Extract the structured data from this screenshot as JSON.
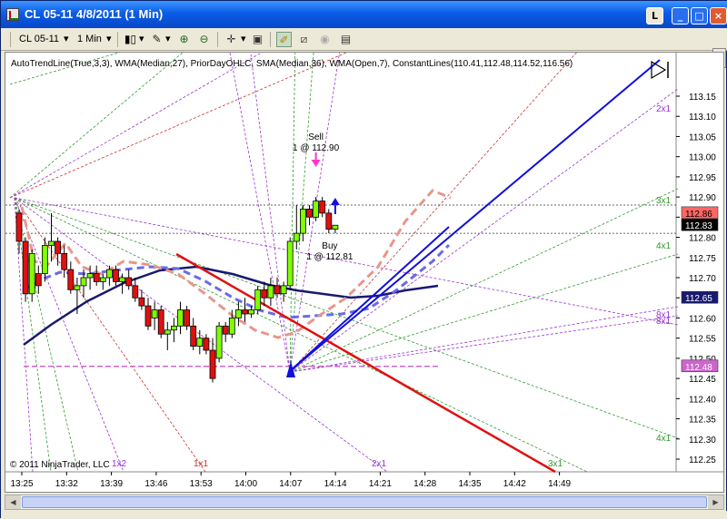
{
  "window": {
    "title": "CL 05-11  4/8/2011 (1 Min)",
    "restore_left": "L",
    "minimize": "_",
    "maximize": "□",
    "close": "×"
  },
  "toolbar": {
    "instrument": "CL 05-11",
    "interval": "1 Min"
  },
  "chart_data": {
    "type": "candlestick",
    "indicators_label": "AutoTrendLine(True,3,3), WMA(Median,27), PriorDayOHLC, SMA(Median,36), WMA(Open,7), ConstantLines(110.41,112.48,114.52,116.56)",
    "copyright": "© 2011 NinjaTrader, LLC",
    "ylim": [
      112.21,
      113.18
    ],
    "y_ticks": [
      113.15,
      113.1,
      113.05,
      113.0,
      112.95,
      112.9,
      112.85,
      112.8,
      112.75,
      112.7,
      112.65,
      112.6,
      112.55,
      112.5,
      112.45,
      112.4,
      112.35,
      112.3,
      112.25
    ],
    "y_tick_labels": [
      "113.15",
      "113.10",
      "113.05",
      "113.00",
      "112.95",
      "112.90",
      "112.85",
      "112.80",
      "112.75",
      "112.70",
      "112.65",
      "112.60",
      "112.55",
      "112.50",
      "112.45",
      "112.40",
      "112.35",
      "112.30",
      "112.25"
    ],
    "x_tick_labels": [
      "13:25",
      "13:32",
      "13:39",
      "13:46",
      "13:53",
      "14:00",
      "14:07",
      "14:14",
      "14:21",
      "14:28",
      "14:35",
      "14:42",
      "14:49"
    ],
    "price_markers": [
      {
        "value": 112.86,
        "label": "112.86",
        "color": "#ff6666"
      },
      {
        "value": 112.83,
        "label": "112.83",
        "color": "#000000"
      },
      {
        "value": 112.65,
        "label": "112.65",
        "color": "#191970"
      },
      {
        "value": 112.48,
        "label": "112.48",
        "color": "#cc66cc"
      }
    ],
    "gann_labels": [
      {
        "text": "2x1",
        "color": "#9933cc"
      },
      {
        "text": "3x1",
        "color": "#339933"
      },
      {
        "text": "4x1",
        "color": "#339933"
      },
      {
        "text": "8x1",
        "color": "#9933cc"
      },
      {
        "text": "8x1",
        "color": "#9933cc"
      },
      {
        "text": "4x1",
        "color": "#339933"
      },
      {
        "text": "1x1",
        "color": "#cc3333"
      },
      {
        "text": "2x1",
        "color": "#9933cc"
      },
      {
        "text": "3x1",
        "color": "#339933"
      },
      {
        "text": "1x2",
        "color": "#9933cc"
      }
    ],
    "trade_sell": {
      "action": "Sell",
      "detail": "1 @ 112.90"
    },
    "trade_buy": {
      "action": "Buy",
      "detail": "1 @ 112.81"
    },
    "candles": [
      {
        "t": 0,
        "o": 112.86,
        "h": 112.87,
        "l": 112.76,
        "c": 112.79
      },
      {
        "t": 1,
        "o": 112.79,
        "h": 112.8,
        "l": 112.64,
        "c": 112.66
      },
      {
        "t": 2,
        "o": 112.66,
        "h": 112.77,
        "l": 112.64,
        "c": 112.76
      },
      {
        "t": 3,
        "o": 112.71,
        "h": 112.73,
        "l": 112.66,
        "c": 112.68
      },
      {
        "t": 4,
        "o": 112.71,
        "h": 112.8,
        "l": 112.69,
        "c": 112.78
      },
      {
        "t": 5,
        "o": 112.78,
        "h": 112.86,
        "l": 112.74,
        "c": 112.79
      },
      {
        "t": 6,
        "o": 112.79,
        "h": 112.8,
        "l": 112.73,
        "c": 112.76
      },
      {
        "t": 7,
        "o": 112.76,
        "h": 112.78,
        "l": 112.7,
        "c": 112.72
      },
      {
        "t": 8,
        "o": 112.72,
        "h": 112.74,
        "l": 112.66,
        "c": 112.67
      },
      {
        "t": 9,
        "o": 112.67,
        "h": 112.7,
        "l": 112.61,
        "c": 112.68
      },
      {
        "t": 10,
        "o": 112.68,
        "h": 112.72,
        "l": 112.65,
        "c": 112.7
      },
      {
        "t": 11,
        "o": 112.7,
        "h": 112.73,
        "l": 112.67,
        "c": 112.71
      },
      {
        "t": 12,
        "o": 112.71,
        "h": 112.73,
        "l": 112.68,
        "c": 112.69
      },
      {
        "t": 13,
        "o": 112.69,
        "h": 112.71,
        "l": 112.67,
        "c": 112.7
      },
      {
        "t": 14,
        "o": 112.7,
        "h": 112.73,
        "l": 112.68,
        "c": 112.72
      },
      {
        "t": 15,
        "o": 112.72,
        "h": 112.73,
        "l": 112.68,
        "c": 112.69
      },
      {
        "t": 16,
        "o": 112.69,
        "h": 112.71,
        "l": 112.66,
        "c": 112.7
      },
      {
        "t": 17,
        "o": 112.7,
        "h": 112.72,
        "l": 112.67,
        "c": 112.68
      },
      {
        "t": 18,
        "o": 112.68,
        "h": 112.7,
        "l": 112.64,
        "c": 112.65
      },
      {
        "t": 19,
        "o": 112.65,
        "h": 112.67,
        "l": 112.62,
        "c": 112.63
      },
      {
        "t": 20,
        "o": 112.63,
        "h": 112.65,
        "l": 112.57,
        "c": 112.58
      },
      {
        "t": 21,
        "o": 112.6,
        "h": 112.64,
        "l": 112.57,
        "c": 112.62
      },
      {
        "t": 22,
        "o": 112.62,
        "h": 112.63,
        "l": 112.55,
        "c": 112.56
      },
      {
        "t": 23,
        "o": 112.56,
        "h": 112.59,
        "l": 112.52,
        "c": 112.57
      },
      {
        "t": 24,
        "o": 112.57,
        "h": 112.6,
        "l": 112.54,
        "c": 112.58
      },
      {
        "t": 25,
        "o": 112.58,
        "h": 112.64,
        "l": 112.56,
        "c": 112.62
      },
      {
        "t": 26,
        "o": 112.62,
        "h": 112.63,
        "l": 112.57,
        "c": 112.58
      },
      {
        "t": 27,
        "o": 112.58,
        "h": 112.6,
        "l": 112.52,
        "c": 112.53
      },
      {
        "t": 28,
        "o": 112.53,
        "h": 112.57,
        "l": 112.51,
        "c": 112.55
      },
      {
        "t": 29,
        "o": 112.55,
        "h": 112.56,
        "l": 112.51,
        "c": 112.52
      },
      {
        "t": 30,
        "o": 112.52,
        "h": 112.55,
        "l": 112.44,
        "c": 112.45
      },
      {
        "t": 31,
        "o": 112.5,
        "h": 112.59,
        "l": 112.49,
        "c": 112.58
      },
      {
        "t": 32,
        "o": 112.58,
        "h": 112.59,
        "l": 112.54,
        "c": 112.56
      },
      {
        "t": 33,
        "o": 112.56,
        "h": 112.62,
        "l": 112.55,
        "c": 112.6
      },
      {
        "t": 34,
        "o": 112.6,
        "h": 112.64,
        "l": 112.58,
        "c": 112.62
      },
      {
        "t": 35,
        "o": 112.62,
        "h": 112.65,
        "l": 112.59,
        "c": 112.61
      },
      {
        "t": 36,
        "o": 112.61,
        "h": 112.63,
        "l": 112.6,
        "c": 112.62
      },
      {
        "t": 37,
        "o": 112.62,
        "h": 112.68,
        "l": 112.61,
        "c": 112.67
      },
      {
        "t": 38,
        "o": 112.67,
        "h": 112.69,
        "l": 112.63,
        "c": 112.65
      },
      {
        "t": 39,
        "o": 112.65,
        "h": 112.7,
        "l": 112.63,
        "c": 112.68
      },
      {
        "t": 40,
        "o": 112.68,
        "h": 112.7,
        "l": 112.65,
        "c": 112.66
      },
      {
        "t": 41,
        "o": 112.66,
        "h": 112.69,
        "l": 112.64,
        "c": 112.68
      },
      {
        "t": 42,
        "o": 112.68,
        "h": 112.8,
        "l": 112.67,
        "c": 112.79
      },
      {
        "t": 43,
        "o": 112.79,
        "h": 112.88,
        "l": 112.77,
        "c": 112.81
      },
      {
        "t": 44,
        "o": 112.81,
        "h": 112.88,
        "l": 112.79,
        "c": 112.87
      },
      {
        "t": 45,
        "o": 112.87,
        "h": 112.88,
        "l": 112.83,
        "c": 112.85
      },
      {
        "t": 46,
        "o": 112.85,
        "h": 112.9,
        "l": 112.84,
        "c": 112.89
      },
      {
        "t": 47,
        "o": 112.89,
        "h": 112.9,
        "l": 112.85,
        "c": 112.86
      },
      {
        "t": 48,
        "o": 112.86,
        "h": 112.87,
        "l": 112.81,
        "c": 112.82
      },
      {
        "t": 49,
        "o": 112.82,
        "h": 112.83,
        "l": 112.81,
        "c": 112.83
      }
    ]
  }
}
